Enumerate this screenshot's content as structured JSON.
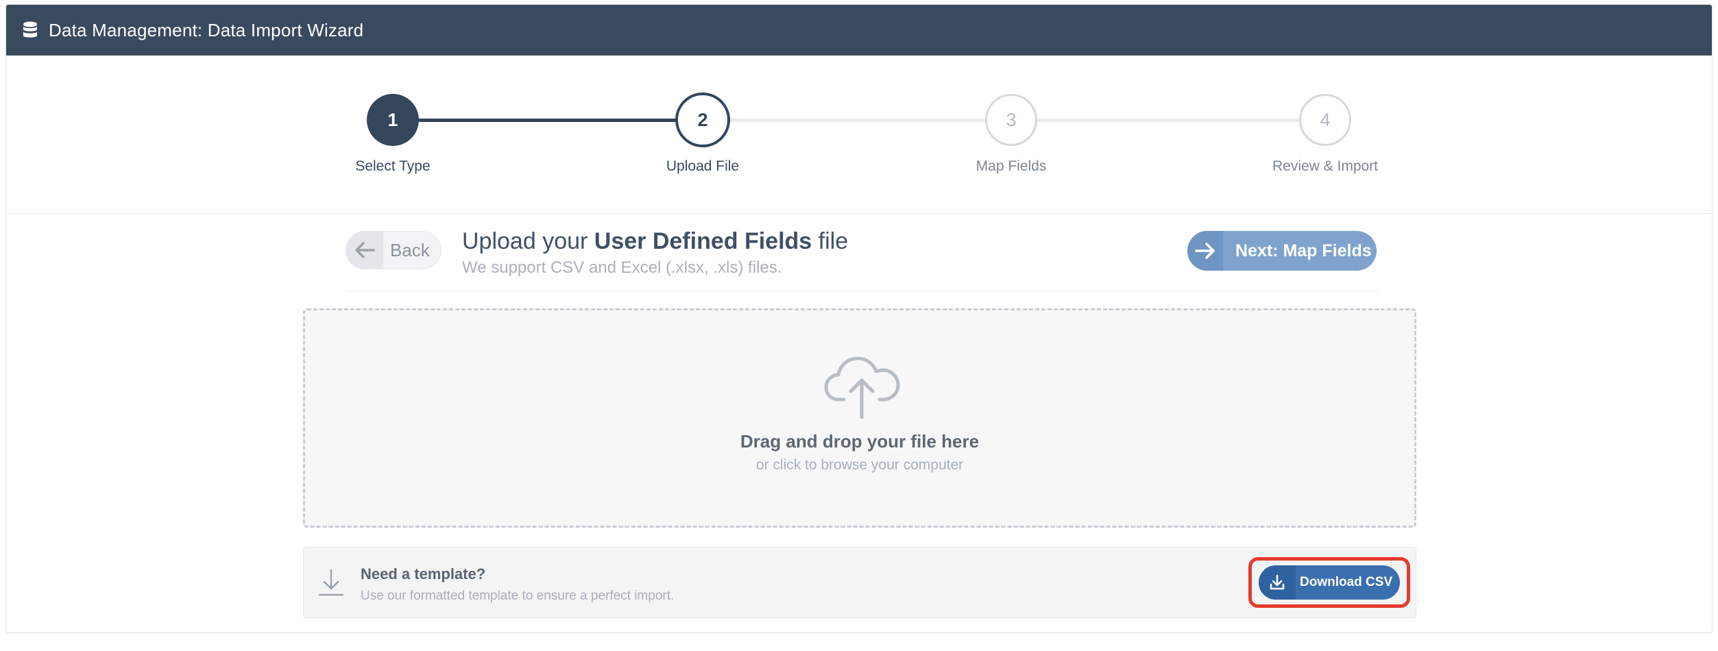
{
  "window": {
    "title": "Data Management: Data Import Wizard",
    "icon": "database-icon"
  },
  "stepper": {
    "steps": [
      {
        "number": "1",
        "label": "Select Type",
        "state": "completed"
      },
      {
        "number": "2",
        "label": "Upload File",
        "state": "active"
      },
      {
        "number": "3",
        "label": "Map Fields",
        "state": "upcoming"
      },
      {
        "number": "4",
        "label": "Review & Import",
        "state": "upcoming"
      }
    ]
  },
  "header": {
    "back_label": "Back",
    "title_prefix": "Upload your ",
    "title_bold": "User Defined Fields",
    "title_suffix": " file",
    "subtitle": "We support CSV and Excel (.xlsx, .xls) files.",
    "next_label": "Next: Map Fields"
  },
  "dropzone": {
    "icon": "cloud-upload-icon",
    "title": "Drag and drop your file here",
    "subtitle": "or click to browse your computer"
  },
  "template": {
    "icon": "download-icon",
    "title": "Need a template?",
    "subtitle": "Use our formatted template to ensure a perfect import.",
    "button_label": "Download CSV"
  },
  "colors": {
    "header_bg": "#3a4a5e",
    "step_active": "#34465c",
    "step_inactive": "#d5d8dc",
    "next_button": "#7fa3cc",
    "download_button": "#3a6fae",
    "highlight": "#e53a2b"
  }
}
